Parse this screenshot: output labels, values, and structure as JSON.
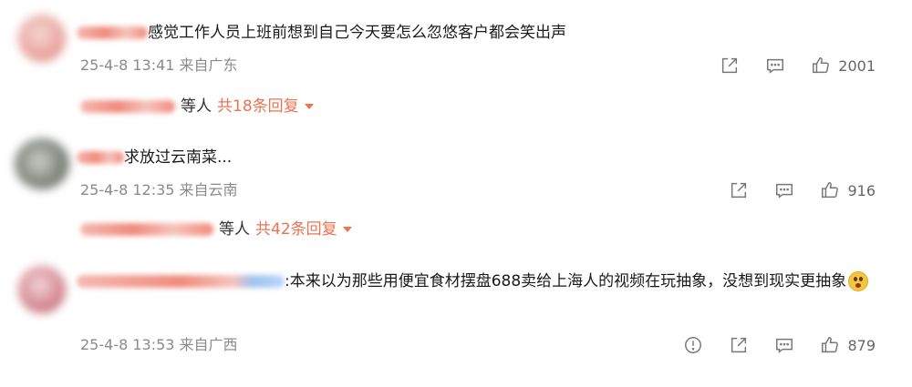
{
  "comments": [
    {
      "text": "感觉工作人员上班前想到自己今天要怎么忽悠客户都会笑出声",
      "meta": "25-4-8 13:41 来自广东",
      "like_count": "2001",
      "reply_people": "等人",
      "reply_count": "共18条回复"
    },
    {
      "text": "求放过云南菜...",
      "meta": "25-4-8 12:35 来自云南",
      "like_count": "916",
      "reply_people": "等人",
      "reply_count": "共42条回复"
    },
    {
      "text": ":本来以为那些用便宜食材摆盘688卖给上海人的视频在玩抽象，没想到现实更抽象",
      "meta": "25-4-8 13:53 来自广西",
      "like_count": "879"
    }
  ],
  "icons": {
    "share": "share-icon",
    "comment": "comment-icon",
    "like": "thumbs-up-icon",
    "report": "report-icon",
    "caret": "caret-down-icon",
    "emoji": "surprised-emoji-icon"
  },
  "colors": {
    "accent": "#eb7350",
    "meta_text": "#8a8a8a",
    "body_text": "#1a1a1a",
    "icon": "#777777"
  }
}
